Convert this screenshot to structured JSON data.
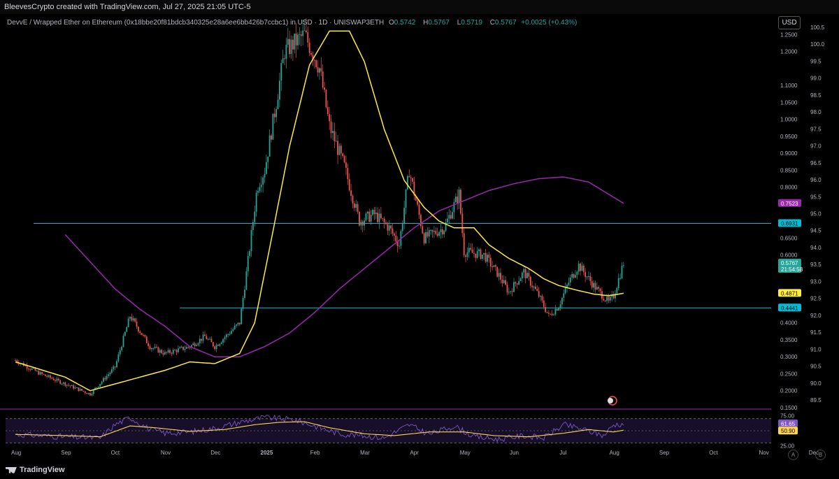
{
  "header": {
    "credit": "BleevesCrypto created with TradingView.com, Jul 27, 2025 21:05 UTC-5",
    "symbol": "DevvE / Wrapped Ether on Ethereum (0x18bbe20f81bdcb340325e28a6ee6bb426b7ccbc1) in USD · 1D · UNISWAP3ETH",
    "open_label": "O",
    "open": "0.5742",
    "high_label": "H",
    "high": "0.5767",
    "low_label": "L",
    "low": "0.5719",
    "close_label": "C",
    "close": "0.5767",
    "change": "+0.0025 (+0.43%)",
    "currency": "USD"
  },
  "footer": {
    "logo": "TradingView",
    "auto_button": "A",
    "log_button": "B"
  },
  "colors": {
    "up": "#26a69a",
    "down": "#ef5350",
    "ma_fast": "#ffeb3b",
    "ma_slow": "#9c27b0",
    "hline": "#00bcd4",
    "rsi": "#7e57c2",
    "rsi_ma": "#ffd54f"
  },
  "chart_data": [
    {
      "type": "candlestick",
      "x_tick_labels": [
        "Aug",
        "Sep",
        "Oct",
        "Nov",
        "Dec",
        "2025",
        "Feb",
        "Mar",
        "Apr",
        "May",
        "Jun",
        "Jul",
        "Aug",
        "Sep",
        "Oct",
        "Nov",
        "Dec"
      ],
      "y_tick_labels": [
        "1.2500",
        "1.2000",
        "1.1000",
        "1.0500",
        "1.0000",
        "0.9500",
        "0.9000",
        "0.8500",
        "0.8000",
        "0.6500",
        "0.6000",
        "0.3500",
        "0.3000",
        "0.2500",
        "0.2000",
        "0.1500",
        "0.4000"
      ],
      "y2_tick_labels": [
        "100.5",
        "100.0",
        "99.5",
        "99.0",
        "98.5",
        "98.0",
        "97.5",
        "97.0",
        "96.5",
        "96.0",
        "95.5",
        "95.0",
        "94.5",
        "94.0",
        "93.5",
        "93.0",
        "92.5",
        "92.0",
        "91.5",
        "91.0",
        "90.5",
        "90.0",
        "89.5"
      ],
      "price_path": [
        [
          0,
          0.29
        ],
        [
          0.5,
          0.25
        ],
        [
          1.0,
          0.22
        ],
        [
          1.5,
          0.19
        ],
        [
          2.0,
          0.27
        ],
        [
          2.3,
          0.42
        ],
        [
          2.7,
          0.33
        ],
        [
          3.0,
          0.31
        ],
        [
          3.5,
          0.33
        ],
        [
          3.8,
          0.36
        ],
        [
          4.0,
          0.33
        ],
        [
          4.5,
          0.4
        ],
        [
          4.7,
          0.62
        ],
        [
          4.85,
          0.8
        ],
        [
          5.0,
          0.85
        ],
        [
          5.2,
          1.02
        ],
        [
          5.4,
          1.2
        ],
        [
          5.8,
          1.25
        ],
        [
          6.1,
          1.15
        ],
        [
          6.3,
          0.98
        ],
        [
          6.6,
          0.86
        ],
        [
          6.9,
          0.7
        ],
        [
          7.2,
          0.72
        ],
        [
          7.5,
          0.68
        ],
        [
          7.7,
          0.63
        ],
        [
          7.9,
          0.85
        ],
        [
          8.2,
          0.65
        ],
        [
          8.6,
          0.68
        ],
        [
          8.9,
          0.78
        ],
        [
          9.0,
          0.61
        ],
        [
          9.4,
          0.6
        ],
        [
          9.7,
          0.54
        ],
        [
          9.9,
          0.49
        ],
        [
          10.2,
          0.55
        ],
        [
          10.5,
          0.48
        ],
        [
          10.7,
          0.42
        ],
        [
          10.9,
          0.45
        ],
        [
          11.1,
          0.52
        ],
        [
          11.3,
          0.57
        ],
        [
          11.6,
          0.51
        ],
        [
          11.9,
          0.46
        ],
        [
          12.0,
          0.48
        ],
        [
          12.2,
          0.5767
        ]
      ],
      "ma_fast_path": [
        [
          0,
          0.285
        ],
        [
          1.0,
          0.24
        ],
        [
          1.5,
          0.2
        ],
        [
          2.0,
          0.22
        ],
        [
          3.0,
          0.26
        ],
        [
          3.5,
          0.285
        ],
        [
          4.0,
          0.28
        ],
        [
          4.5,
          0.31
        ],
        [
          4.8,
          0.4
        ],
        [
          5.1,
          0.62
        ],
        [
          5.5,
          0.92
        ],
        [
          5.9,
          1.16
        ],
        [
          6.3,
          1.26
        ],
        [
          6.7,
          1.26
        ],
        [
          7.0,
          1.17
        ],
        [
          7.4,
          0.97
        ],
        [
          7.8,
          0.82
        ],
        [
          8.2,
          0.74
        ],
        [
          8.5,
          0.7
        ],
        [
          8.8,
          0.68
        ],
        [
          9.2,
          0.68
        ],
        [
          9.5,
          0.63
        ],
        [
          9.9,
          0.59
        ],
        [
          10.3,
          0.56
        ],
        [
          10.6,
          0.53
        ],
        [
          10.9,
          0.51
        ],
        [
          11.3,
          0.495
        ],
        [
          11.6,
          0.485
        ],
        [
          11.9,
          0.48
        ],
        [
          12.2,
          0.4871
        ]
      ],
      "ma_slow_path": [
        [
          1.0,
          0.66
        ],
        [
          1.5,
          0.58
        ],
        [
          2.0,
          0.5
        ],
        [
          2.5,
          0.44
        ],
        [
          3.0,
          0.39
        ],
        [
          3.5,
          0.33
        ],
        [
          4.0,
          0.3
        ],
        [
          4.5,
          0.3
        ],
        [
          5.0,
          0.33
        ],
        [
          5.5,
          0.37
        ],
        [
          6.0,
          0.43
        ],
        [
          6.5,
          0.5
        ],
        [
          7.0,
          0.56
        ],
        [
          7.5,
          0.62
        ],
        [
          8.0,
          0.68
        ],
        [
          8.5,
          0.73
        ],
        [
          9.0,
          0.76
        ],
        [
          9.5,
          0.79
        ],
        [
          10.0,
          0.81
        ],
        [
          10.5,
          0.825
        ],
        [
          11.0,
          0.83
        ],
        [
          11.5,
          0.815
        ],
        [
          12.2,
          0.7523
        ]
      ],
      "horizontal_levels": [
        0.6931,
        0.4441
      ],
      "price_labels": [
        {
          "value": 0.7523,
          "text": "0.7523",
          "series": "ma_slow"
        },
        {
          "value": 0.6931,
          "text": "0.6931",
          "series": "hline"
        },
        {
          "value": 0.5767,
          "text": "0.5767",
          "sub": "21:54:58",
          "series": "last"
        },
        {
          "value": 0.4871,
          "text": "0.4871",
          "series": "ma_fast"
        },
        {
          "value": 0.4441,
          "text": "0.4441",
          "series": "hline"
        }
      ],
      "ylim": [
        0.15,
        1.3
      ]
    },
    {
      "type": "line",
      "name": "RSI",
      "y_tick_labels": [
        "75.00",
        "25.00"
      ],
      "ylim": [
        20,
        80
      ],
      "band": [
        30,
        70
      ],
      "rsi_value": "61.65",
      "rsi_ma_value": "50.90",
      "rsi_path": [
        [
          0,
          44
        ],
        [
          1.0,
          40
        ],
        [
          1.7,
          38
        ],
        [
          2.0,
          60
        ],
        [
          2.3,
          72
        ],
        [
          2.7,
          52
        ],
        [
          3.0,
          46
        ],
        [
          3.5,
          48
        ],
        [
          4.0,
          54
        ],
        [
          4.6,
          66
        ],
        [
          5.0,
          72
        ],
        [
          5.3,
          70
        ],
        [
          5.6,
          68
        ],
        [
          6.0,
          58
        ],
        [
          6.5,
          45
        ],
        [
          7.0,
          42
        ],
        [
          7.4,
          38
        ],
        [
          7.9,
          60
        ],
        [
          8.3,
          44
        ],
        [
          8.8,
          58
        ],
        [
          9.2,
          40
        ],
        [
          9.7,
          36
        ],
        [
          10.2,
          42
        ],
        [
          10.6,
          38
        ],
        [
          11.0,
          60
        ],
        [
          11.4,
          52
        ],
        [
          11.8,
          42
        ],
        [
          12.0,
          60
        ],
        [
          12.2,
          61.65
        ]
      ],
      "rsi_ma_path": [
        [
          0,
          44
        ],
        [
          1.0,
          42
        ],
        [
          1.7,
          40
        ],
        [
          2.3,
          58
        ],
        [
          2.8,
          55
        ],
        [
          3.5,
          49
        ],
        [
          4.2,
          52
        ],
        [
          4.8,
          60
        ],
        [
          5.3,
          64
        ],
        [
          5.8,
          65
        ],
        [
          6.3,
          55
        ],
        [
          7.0,
          45
        ],
        [
          7.6,
          42
        ],
        [
          8.3,
          48
        ],
        [
          9.0,
          48
        ],
        [
          9.6,
          42
        ],
        [
          10.3,
          40
        ],
        [
          11.0,
          46
        ],
        [
          11.5,
          52
        ],
        [
          12.0,
          48
        ],
        [
          12.2,
          50.9
        ]
      ]
    }
  ]
}
